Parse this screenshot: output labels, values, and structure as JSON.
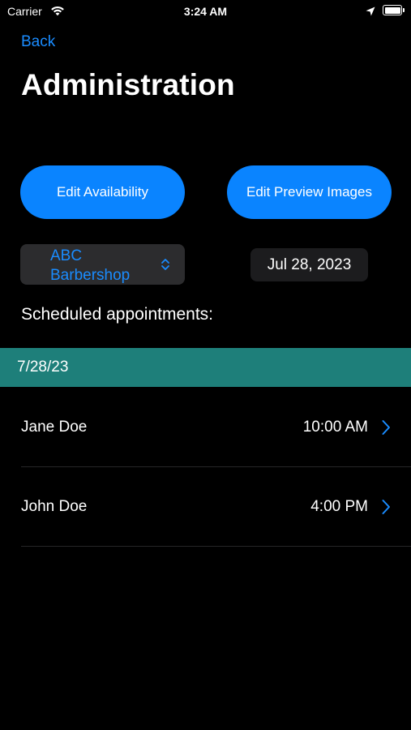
{
  "status_bar": {
    "carrier": "Carrier",
    "time": "3:24 AM"
  },
  "nav": {
    "back_label": "Back",
    "title": "Administration"
  },
  "actions": {
    "edit_availability": "Edit Availability",
    "edit_preview_images": "Edit Preview Images"
  },
  "shop_picker": {
    "selected": "ABC Barbershop"
  },
  "date_picker": {
    "value": "Jul 28, 2023"
  },
  "appointments": {
    "section_label": "Scheduled appointments:",
    "date_header": "7/28/23",
    "items": [
      {
        "name": "Jane Doe",
        "time": "10:00 AM"
      },
      {
        "name": "John Doe",
        "time": "4:00 PM"
      }
    ]
  },
  "colors": {
    "accent": "#0a84ff",
    "link": "#1a8cff",
    "date_header_bg": "#1e7f7a",
    "background": "#000000"
  },
  "icons": {
    "wifi": "wifi-icon",
    "location": "location-arrow-icon",
    "battery": "battery-icon",
    "picker": "chevron-up-down-icon",
    "row": "chevron-right-icon"
  }
}
